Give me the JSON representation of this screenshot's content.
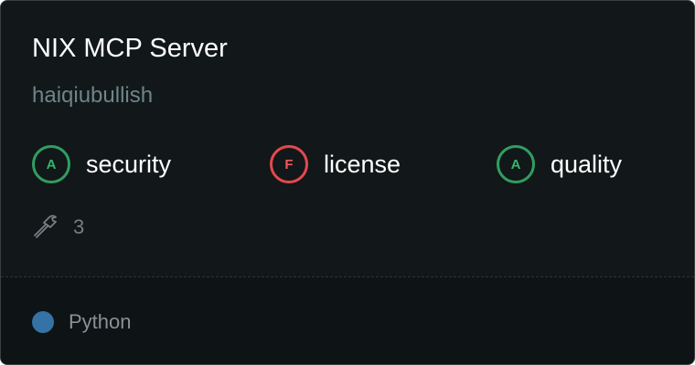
{
  "server": {
    "name": "NIX MCP Server",
    "author": "haiqiubullish"
  },
  "grades": [
    {
      "letter": "A",
      "label": "security",
      "status": "pass",
      "color": "#2f9e61"
    },
    {
      "letter": "F",
      "label": "license",
      "status": "fail",
      "color": "#e5484d"
    },
    {
      "letter": "A",
      "label": "quality",
      "status": "pass",
      "color": "#2f9e61"
    }
  ],
  "tools": {
    "icon": "hammer-icon",
    "count": "3"
  },
  "language": {
    "name": "Python",
    "color": "#3572a5"
  }
}
